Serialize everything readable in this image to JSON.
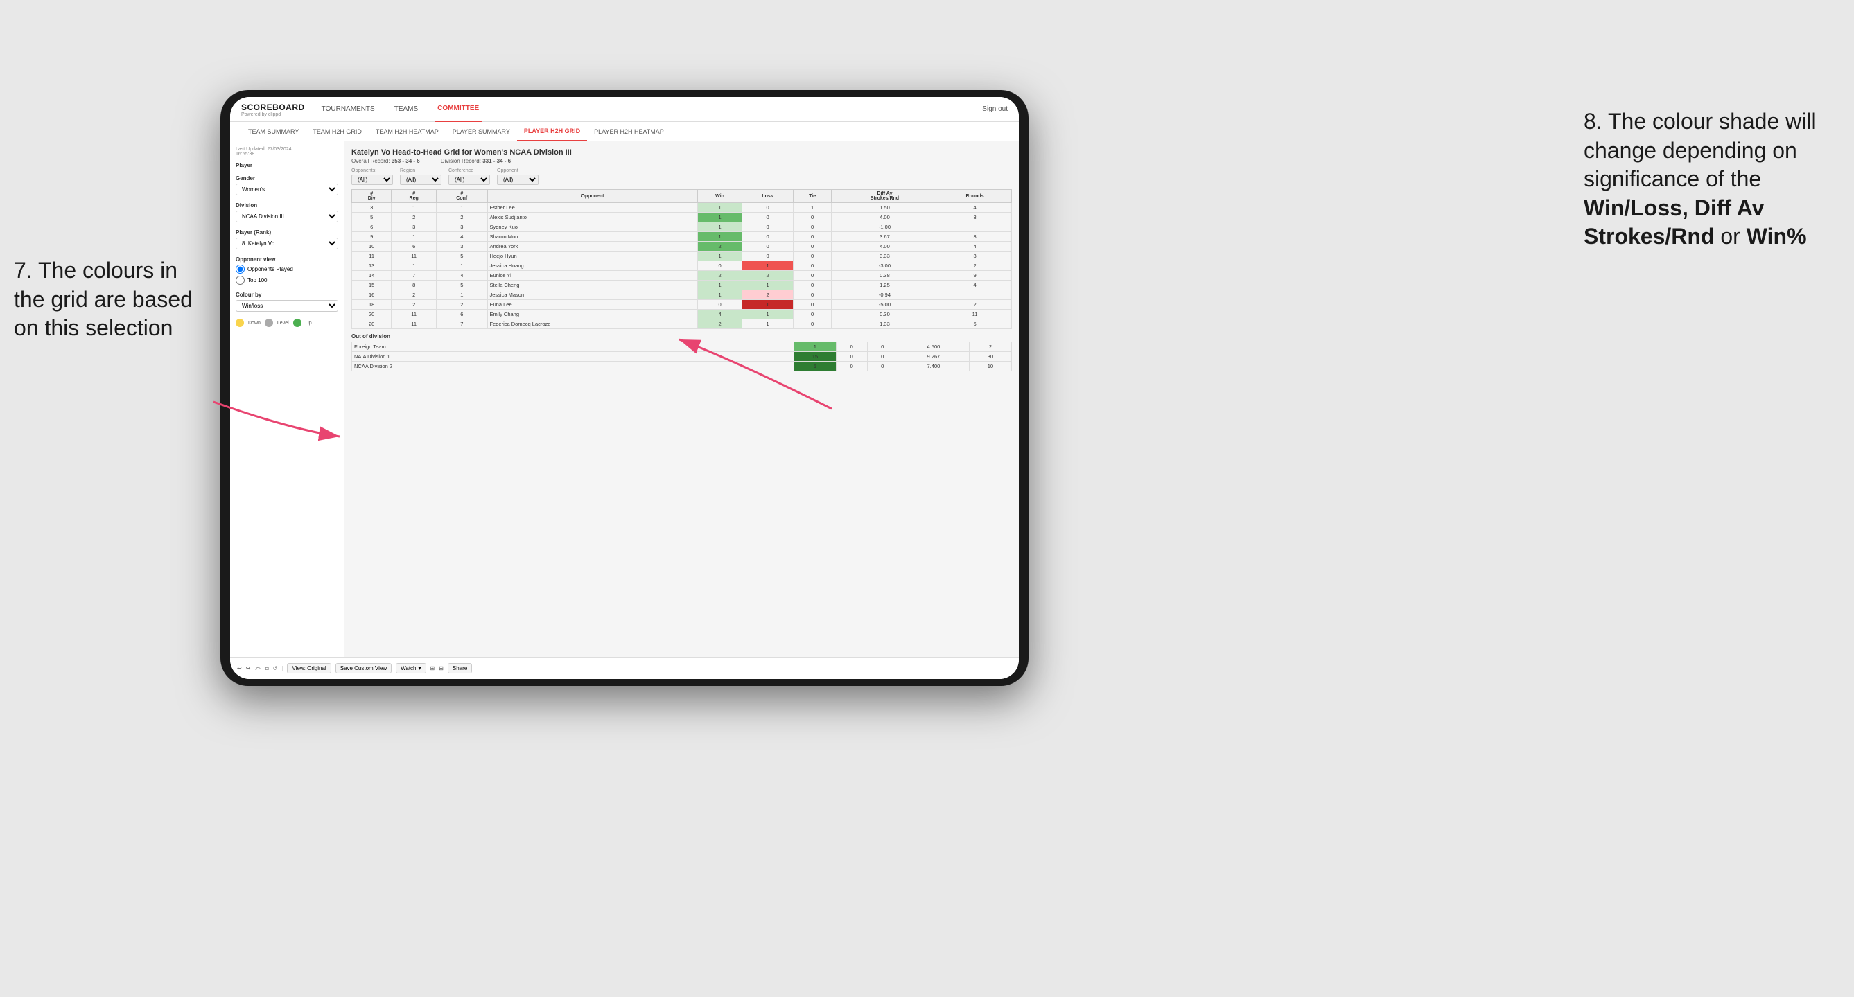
{
  "annotations": {
    "left_title": "7. The colours in the grid are based on this selection",
    "right_title": "8. The colour shade will change depending on significance of the",
    "right_bold": "Win/Loss, Diff Av Strokes/Rnd",
    "right_or": "or",
    "right_bold2": "Win%"
  },
  "nav": {
    "logo": "SCOREBOARD",
    "logo_sub": "Powered by clippd",
    "links": [
      "TOURNAMENTS",
      "TEAMS",
      "COMMITTEE"
    ],
    "active_link": "COMMITTEE",
    "sign_out": "Sign out"
  },
  "sub_nav": {
    "links": [
      "TEAM SUMMARY",
      "TEAM H2H GRID",
      "TEAM H2H HEATMAP",
      "PLAYER SUMMARY",
      "PLAYER H2H GRID",
      "PLAYER H2H HEATMAP"
    ],
    "active": "PLAYER H2H GRID"
  },
  "sidebar": {
    "timestamp_label": "Last Updated: 27/03/2024",
    "timestamp_time": "16:55:38",
    "player_label": "Player",
    "gender_label": "Gender",
    "gender_value": "Women's",
    "division_label": "Division",
    "division_value": "NCAA Division III",
    "player_rank_label": "Player (Rank)",
    "player_rank_value": "8. Katelyn Vo",
    "opponent_view_label": "Opponent view",
    "opponent_played": "Opponents Played",
    "top100": "Top 100",
    "colour_by_label": "Colour by",
    "colour_by_value": "Win/loss",
    "legend": {
      "down_label": "Down",
      "level_label": "Level",
      "up_label": "Up"
    }
  },
  "report": {
    "title": "Katelyn Vo Head-to-Head Grid for Women's NCAA Division III",
    "overall_record_label": "Overall Record:",
    "overall_record_value": "353 - 34 - 6",
    "division_record_label": "Division Record:",
    "division_record_value": "331 - 34 - 6",
    "filters": {
      "opponents_label": "Opponents:",
      "opponents_value": "(All)",
      "region_label": "Region",
      "region_value": "(All)",
      "conference_label": "Conference",
      "conference_value": "(All)",
      "opponent_label": "Opponent",
      "opponent_value": "(All)"
    },
    "col_headers": {
      "div": "#\nDiv",
      "reg": "#\nReg",
      "conf": "#\nConf",
      "opponent": "Opponent",
      "win": "Win",
      "loss": "Loss",
      "tie": "Tie",
      "diff_av": "Diff Av\nStrokes/Rnd",
      "rounds": "Rounds"
    },
    "rows": [
      {
        "div": "3",
        "reg": "1",
        "conf": "1",
        "opponent": "Esther Lee",
        "win": "1",
        "loss": "0",
        "tie": "1",
        "diff": "1.50",
        "rounds": "4",
        "win_color": "light",
        "loss_color": ""
      },
      {
        "div": "5",
        "reg": "2",
        "conf": "2",
        "opponent": "Alexis Sudjianto",
        "win": "1",
        "loss": "0",
        "tie": "0",
        "diff": "4.00",
        "rounds": "3",
        "win_color": "medium",
        "loss_color": ""
      },
      {
        "div": "6",
        "reg": "3",
        "conf": "3",
        "opponent": "Sydney Kuo",
        "win": "1",
        "loss": "0",
        "tie": "0",
        "diff": "-1.00",
        "rounds": "",
        "win_color": "light",
        "loss_color": ""
      },
      {
        "div": "9",
        "reg": "1",
        "conf": "4",
        "opponent": "Sharon Mun",
        "win": "1",
        "loss": "0",
        "tie": "0",
        "diff": "3.67",
        "rounds": "3",
        "win_color": "medium",
        "loss_color": ""
      },
      {
        "div": "10",
        "reg": "6",
        "conf": "3",
        "opponent": "Andrea York",
        "win": "2",
        "loss": "0",
        "tie": "0",
        "diff": "4.00",
        "rounds": "4",
        "win_color": "medium",
        "loss_color": ""
      },
      {
        "div": "11",
        "reg": "11",
        "conf": "5",
        "opponent": "Heejo Hyun",
        "win": "1",
        "loss": "0",
        "tie": "0",
        "diff": "3.33",
        "rounds": "3",
        "win_color": "medium",
        "loss_color": ""
      },
      {
        "div": "13",
        "reg": "1",
        "conf": "1",
        "opponent": "Jessica Huang",
        "win": "0",
        "loss": "1",
        "tie": "0",
        "diff": "-3.00",
        "rounds": "2",
        "win_color": "",
        "loss_color": "medium"
      },
      {
        "div": "14",
        "reg": "7",
        "conf": "4",
        "opponent": "Eunice Yi",
        "win": "2",
        "loss": "2",
        "tie": "0",
        "diff": "0.38",
        "rounds": "9",
        "win_color": "light",
        "loss_color": ""
      },
      {
        "div": "15",
        "reg": "8",
        "conf": "5",
        "opponent": "Stella Cheng",
        "win": "1",
        "loss": "1",
        "tie": "0",
        "diff": "1.25",
        "rounds": "4",
        "win_color": "light",
        "loss_color": ""
      },
      {
        "div": "16",
        "reg": "2",
        "conf": "1",
        "opponent": "Jessica Mason",
        "win": "1",
        "loss": "2",
        "tie": "0",
        "diff": "-0.94",
        "rounds": "",
        "win_color": "",
        "loss_color": "light"
      },
      {
        "div": "18",
        "reg": "2",
        "conf": "2",
        "opponent": "Euna Lee",
        "win": "0",
        "loss": "1",
        "tie": "0",
        "diff": "-5.00",
        "rounds": "2",
        "win_color": "",
        "loss_color": "strong"
      },
      {
        "div": "20",
        "reg": "11",
        "conf": "6",
        "opponent": "Emily Chang",
        "win": "4",
        "loss": "1",
        "tie": "0",
        "diff": "0.30",
        "rounds": "11",
        "win_color": "light",
        "loss_color": ""
      },
      {
        "div": "20",
        "reg": "11",
        "conf": "7",
        "opponent": "Federica Domecq Lacroze",
        "win": "2",
        "loss": "1",
        "tie": "0",
        "diff": "1.33",
        "rounds": "6",
        "win_color": "light",
        "loss_color": ""
      }
    ],
    "out_of_division_label": "Out of division",
    "out_of_division_rows": [
      {
        "opponent": "Foreign Team",
        "win": "1",
        "loss": "0",
        "tie": "0",
        "diff": "4.500",
        "rounds": "2",
        "win_color": "medium"
      },
      {
        "opponent": "NAIA Division 1",
        "win": "15",
        "loss": "0",
        "tie": "0",
        "diff": "9.267",
        "rounds": "30",
        "win_color": "strong"
      },
      {
        "opponent": "NCAA Division 2",
        "win": "5",
        "loss": "0",
        "tie": "0",
        "diff": "7.400",
        "rounds": "10",
        "win_color": "strong"
      }
    ]
  },
  "toolbar": {
    "view_original": "View: Original",
    "save_custom": "Save Custom View",
    "watch": "Watch",
    "share": "Share"
  }
}
